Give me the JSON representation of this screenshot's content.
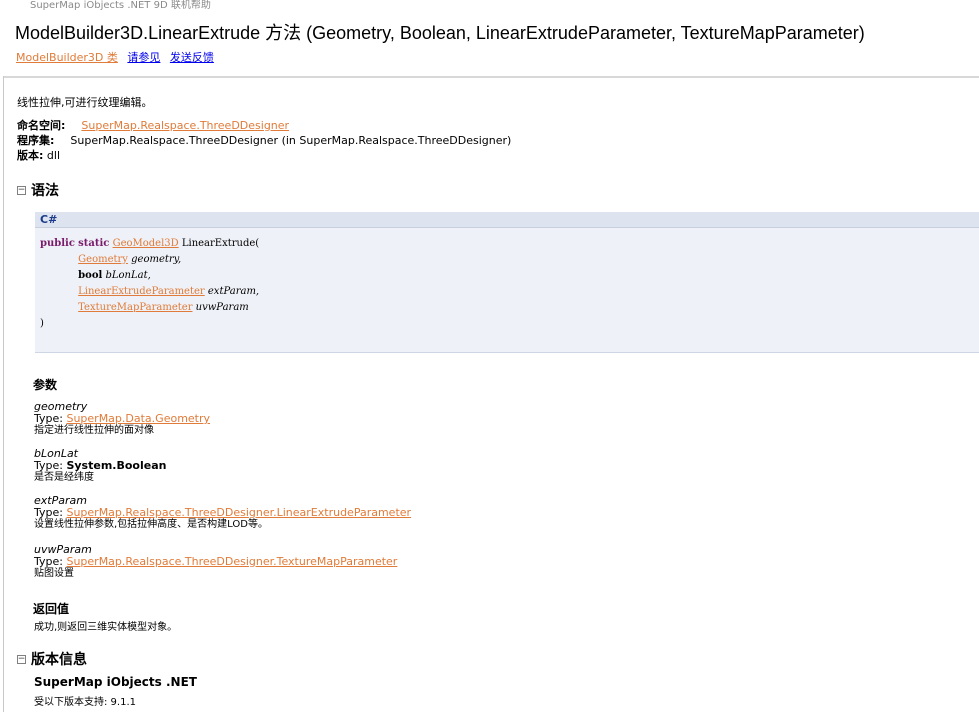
{
  "header": {
    "product": "SuperMap iObjects .NET 9D 联机帮助",
    "title": "ModelBuilder3D.LinearExtrude 方法 (Geometry, Boolean, LinearExtrudeParameter, TextureMapParameter)",
    "links": [
      "ModelBuilder3D 类",
      "请参见",
      "发送反馈"
    ]
  },
  "summary": "线性拉伸,可进行纹理编辑。",
  "meta": {
    "namespace_label": "命名空间:",
    "namespace_value": "SuperMap.Realspace.ThreeDDesigner",
    "assembly_label": "程序集:",
    "assembly_value": "SuperMap.Realspace.ThreeDDesigner (in SuperMap.Realspace.ThreeDDesigner)",
    "version_label": "版本:",
    "version_value": "dll"
  },
  "sections": {
    "syntax": "语法",
    "parameters": "参数",
    "return_value": "返回值",
    "version_info": "版本信息"
  },
  "code": {
    "language": "C#",
    "kw_public": "public",
    "kw_static": "static",
    "return_type": "GeoModel3D",
    "method": "LinearExtrude(",
    "params": [
      {
        "type": "Geometry",
        "type_is_link": true,
        "name": "geometry,"
      },
      {
        "type": "bool",
        "type_is_link": false,
        "name": "bLonLat,"
      },
      {
        "type": "LinearExtrudeParameter",
        "type_is_link": true,
        "name": "extParam,"
      },
      {
        "type": "TextureMapParameter",
        "type_is_link": true,
        "name": "uvwParam"
      }
    ],
    "close": ")"
  },
  "parameters": [
    {
      "name": "geometry",
      "type_prefix": "Type: ",
      "type": "SuperMap.Data.Geometry",
      "type_is_link": true,
      "desc": "指定进行线性拉伸的面对像"
    },
    {
      "name": "bLonLat",
      "type_prefix": "Type: ",
      "type": "System.Boolean",
      "type_is_link": false,
      "desc": "是否是经纬度"
    },
    {
      "name": "extParam",
      "type_prefix": "Type: ",
      "type": "SuperMap.Realspace.ThreeDDesigner.LinearExtrudeParameter",
      "type_is_link": true,
      "desc": "设置线性拉伸参数,包括拉伸高度、是否构建LOD等。"
    },
    {
      "name": "uvwParam",
      "type_prefix": "Type: ",
      "type": "SuperMap.Realspace.ThreeDDesigner.TextureMapParameter",
      "type_is_link": true,
      "desc": "贴图设置"
    }
  ],
  "return_value": "成功,则返回三维实体模型对象。",
  "version": {
    "product": "SuperMap iObjects .NET",
    "supported": "受以下版本支持: 9.1.1"
  },
  "colors": {
    "link": "#e07b39",
    "nav_link": "#0000ee",
    "keyword": "#7a1a6a",
    "code_bg": "#eef1f7"
  }
}
